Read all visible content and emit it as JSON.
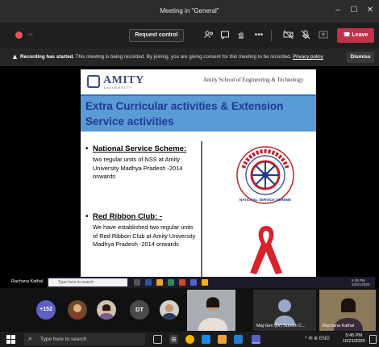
{
  "window": {
    "title": "Meeting in \"General\"",
    "minimize": "–",
    "maximize": "☐",
    "close": "✕"
  },
  "toolbar": {
    "timer": "-:-",
    "request_control": "Request control",
    "leave": "Leave",
    "icons": [
      "participants-icon",
      "chat-icon",
      "raise-hand-icon",
      "more-options-icon",
      "camera-off-icon",
      "mic-off-icon",
      "share-tray-icon"
    ]
  },
  "banner": {
    "bold": "Recording has started.",
    "text": " This meeting is being recorded. By joining, you are giving consent for this meeting to be recorded.",
    "link": "Privacy policy",
    "dismiss": "Dismiss"
  },
  "slide": {
    "logo": "AMITY",
    "logo_sub": "UNIVERSITY",
    "school": "Amity School of Engineering & Technology",
    "heading_line1": "Extra Curricular activities & Extension",
    "heading_line2": "Service activities",
    "items": [
      {
        "bullet": "•",
        "name": "National Service Scheme",
        "suffix": ":",
        "desc": "two regular units of NSS at Amity University Madhya Pradesh -2014 onwards"
      },
      {
        "bullet": "•",
        "name": "Red Ribbon Club",
        "suffix": ": -",
        "desc": "We have established two regular units of Red Ribbon Club at Amity University Madhya Pradesh -2014 onwards"
      }
    ],
    "emblem_text": "NATIONAL SERVICE SCHEME"
  },
  "shared_taskbar": {
    "presenter": "Rachana Kathal",
    "search_placeholder": "Type here to search",
    "time": "5:45 PM",
    "date": "10/21/2020"
  },
  "gallery": {
    "overflow_count": "+152",
    "initials": "DT",
    "tile1_name": "Maj Gen (Dr) Suresh C...",
    "tile2_name": "Rachana Kathal"
  },
  "taskbar": {
    "search_placeholder": "Type here to search",
    "tray": "^ ✉ ⊕ ENG",
    "time": "5:45 PM",
    "date": "10/21/2020"
  },
  "colors": {
    "leave": "#c4314b",
    "accent": "#5b5fc7",
    "slide_heading_bg": "#5b9bd5",
    "slide_heading_text": "#1f3a93"
  }
}
